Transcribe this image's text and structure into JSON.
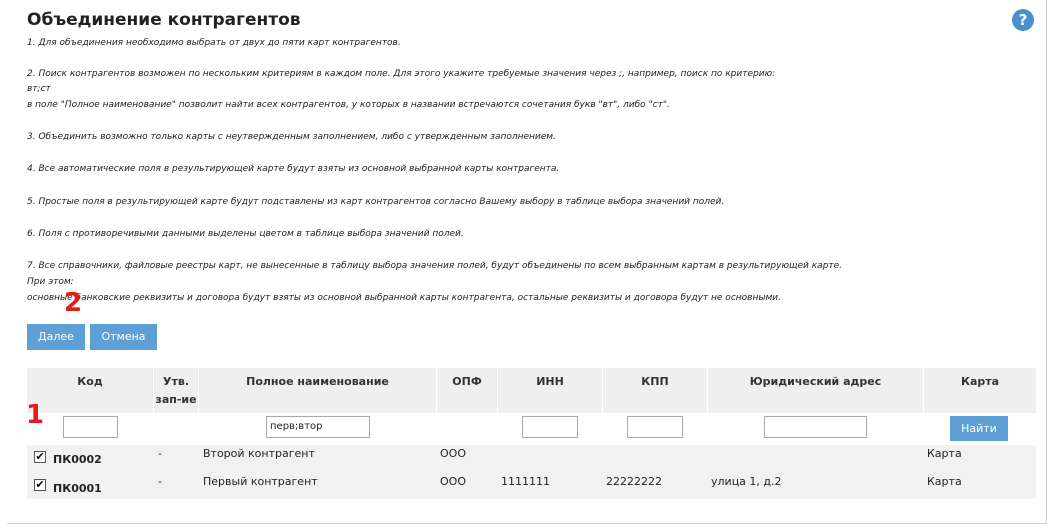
{
  "page": {
    "title": "Объединение контрагентов",
    "help_glyph": "?"
  },
  "instructions": [
    "1. Для объединения необходимо выбрать от двух до пяти карт контрагентов.",
    "2. Поиск контрагентов возможен по нескольким критериям в каждом поле. Для этого укажите требуемые значения через ;, например, поиск по критерию:",
    "вт;ст",
    "в поле \"Полное наименование\" позволит найти всех контрагентов, у которых в названии встречаются сочетания букв \"вт\", либо \"ст\".",
    "3. Объединить возможно только карты с неутвержденным заполнением, либо с утвержденным заполнением.",
    "4. Все автоматические поля в результирующей карте будут взяты из основной выбранной карты контрагента.",
    "5. Простые поля в результирующей карте будут подставлены из карт контрагентов согласно Вашему выбору в таблице выбора значений полей.",
    "6. Поля с противоречивыми данными выделены цветом в таблице выбора значений полей.",
    "7. Все справочники, файловые реестры карт, не вынесенные в таблицу выбора значения полей, будут объединены по всем выбранным картам в результирующей карте.",
    "При этом:",
    "основные банковские реквизиты и договора будут взяты из основной выбранной карты контрагента, остальные реквизиты и договора будут не основными."
  ],
  "buttons": {
    "next": "Далее",
    "cancel": "Отмена",
    "find": "Найти"
  },
  "markers": {
    "one": "1",
    "two": "2"
  },
  "table": {
    "headers": {
      "code": "Код",
      "approved_1": "Утв.",
      "approved_2": "зап-ие",
      "full_name": "Полное наименование",
      "opf": "ОПФ",
      "inn": "ИНН",
      "kpp": "КПП",
      "address": "Юридический адрес",
      "card": "Карта"
    },
    "filters": {
      "code": "",
      "full_name": "перв;втор",
      "inn": "",
      "kpp": "",
      "address": ""
    },
    "rows": [
      {
        "checked": "✔",
        "code": "ПК0002",
        "approved": "-",
        "full_name": "Второй контрагент",
        "opf": "ООО",
        "inn": "",
        "kpp": "",
        "address": "",
        "card": "Карта"
      },
      {
        "checked": "✔",
        "code": "ПК0001",
        "approved": "-",
        "full_name": "Первый контрагент",
        "opf": "ООО",
        "inn": "1111111",
        "kpp": "22222222",
        "address": "улица 1, д.2",
        "card": "Карта"
      }
    ]
  },
  "colors": {
    "accent": "#5e9fd5",
    "marker": "#e31b1b",
    "header_bg": "#efefef"
  }
}
